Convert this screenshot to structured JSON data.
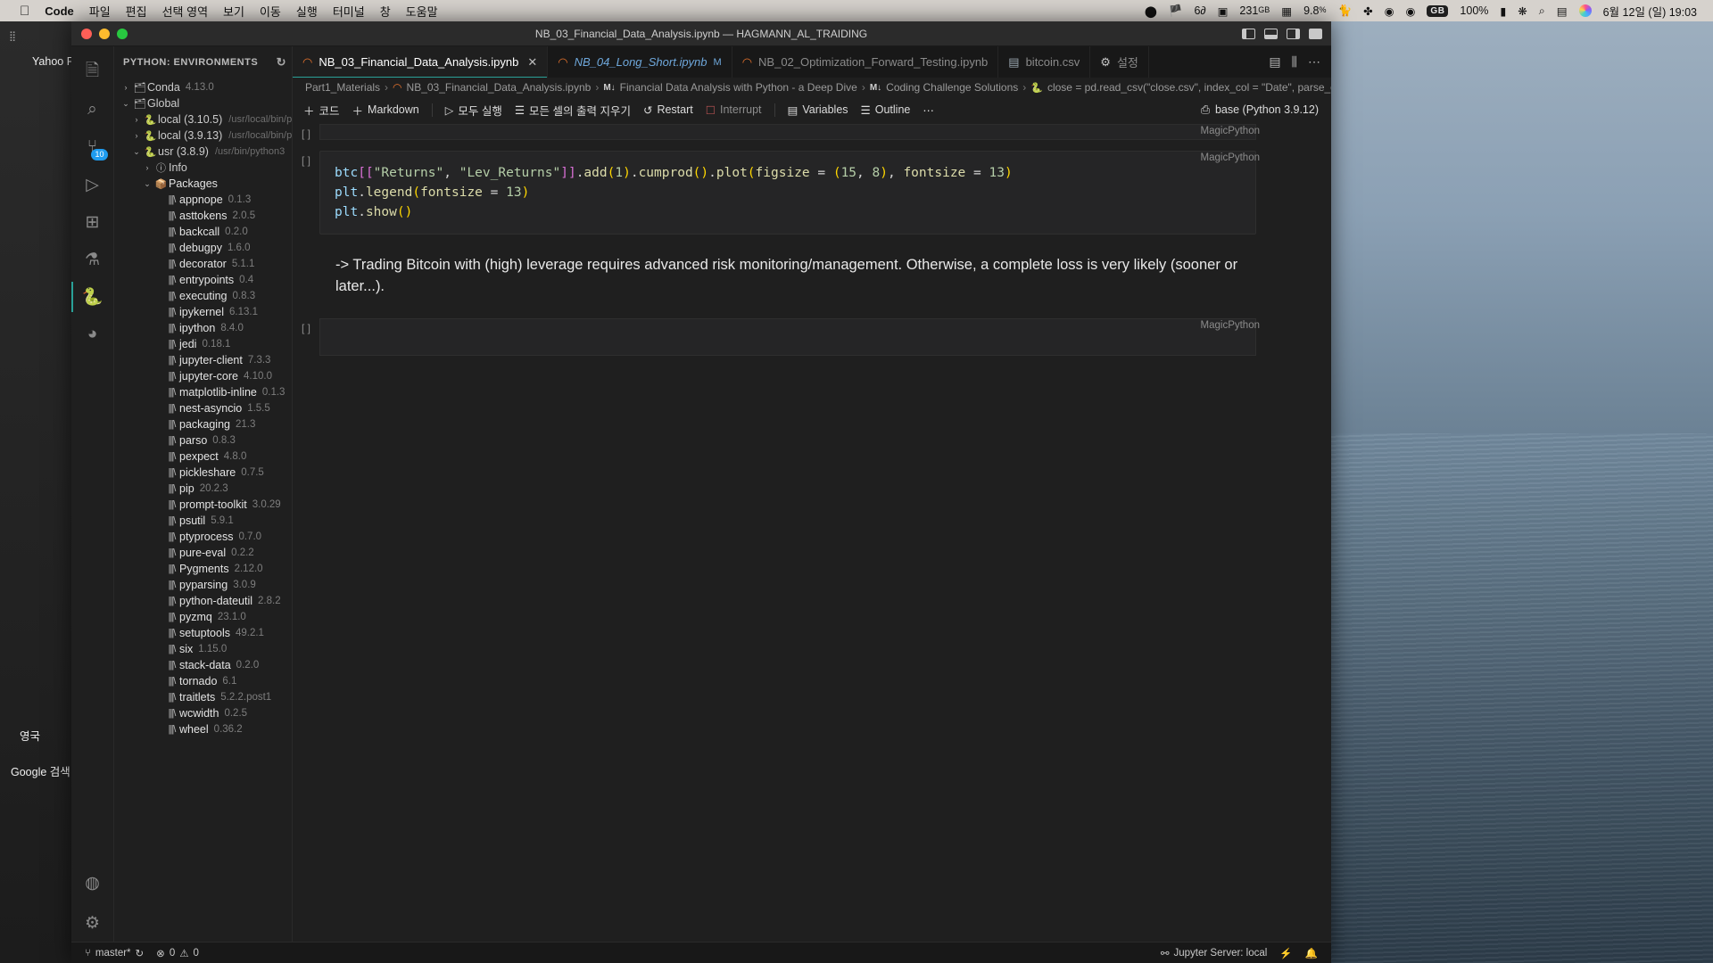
{
  "menubar": {
    "apple": "apple-logo",
    "app": "Code",
    "items": [
      "파일",
      "편집",
      "선택 영역",
      "보기",
      "이동",
      "실행",
      "터미널",
      "창",
      "도움말"
    ],
    "status": {
      "disk_value": "231",
      "disk_unit": "GB",
      "cpu_value": "9.8",
      "cpu_unit": "%",
      "input_source": "GB",
      "battery": "100%",
      "clock": "6월 12일 (일)  19:03"
    }
  },
  "desktop": {
    "left_items": [
      "Yahoo Fin",
      "영국",
      "Google 검색"
    ]
  },
  "window": {
    "title": "NB_03_Financial_Data_Analysis.ipynb — HAGMANN_AL_TRAIDING"
  },
  "activitybar": {
    "items": [
      {
        "name": "explorer",
        "glyph": "🗎",
        "badge": ""
      },
      {
        "name": "search",
        "glyph": "⌕",
        "badge": ""
      },
      {
        "name": "source-control",
        "glyph": "⑂",
        "badge": "10"
      },
      {
        "name": "run-and-debug",
        "glyph": "▷",
        "badge": ""
      },
      {
        "name": "extensions",
        "glyph": "⊞",
        "badge": ""
      },
      {
        "name": "testing",
        "glyph": "⚗",
        "badge": ""
      },
      {
        "name": "python-environments",
        "glyph": "🐍",
        "badge": ""
      },
      {
        "name": "github",
        "glyph": "◕",
        "badge": ""
      }
    ],
    "bottom": [
      {
        "name": "accounts",
        "glyph": "◍"
      },
      {
        "name": "manage-settings",
        "glyph": "⚙"
      }
    ]
  },
  "sidebar": {
    "title": "PYTHON: ENVIRONMENTS",
    "refresh_icon": "↻",
    "tree": [
      {
        "indent": 0,
        "twisty": "›",
        "icon": "env",
        "name": "Conda",
        "ver": "4.13.0",
        "path": ""
      },
      {
        "indent": 0,
        "twisty": "⌄",
        "icon": "env",
        "name": "Global",
        "ver": "",
        "path": ""
      },
      {
        "indent": 1,
        "twisty": "›",
        "icon": "py",
        "name": "local (3.10.5)",
        "ver": "",
        "path": "/usr/local/bin/p..."
      },
      {
        "indent": 1,
        "twisty": "›",
        "icon": "py",
        "name": "local (3.9.13)",
        "ver": "",
        "path": "/usr/local/bin/p..."
      },
      {
        "indent": 1,
        "twisty": "⌄",
        "icon": "py",
        "name": "usr (3.8.9)",
        "ver": "",
        "path": "/usr/bin/python3"
      },
      {
        "indent": 2,
        "twisty": "›",
        "icon": "info",
        "name": "Info",
        "ver": "",
        "path": ""
      },
      {
        "indent": 2,
        "twisty": "⌄",
        "icon": "packages",
        "name": "Packages",
        "ver": "",
        "path": ""
      },
      {
        "indent": 3,
        "twisty": "",
        "icon": "pkg",
        "name": "appnope",
        "ver": "0.1.3",
        "path": ""
      },
      {
        "indent": 3,
        "twisty": "",
        "icon": "pkg",
        "name": "asttokens",
        "ver": "2.0.5",
        "path": ""
      },
      {
        "indent": 3,
        "twisty": "",
        "icon": "pkg",
        "name": "backcall",
        "ver": "0.2.0",
        "path": ""
      },
      {
        "indent": 3,
        "twisty": "",
        "icon": "pkg",
        "name": "debugpy",
        "ver": "1.6.0",
        "path": ""
      },
      {
        "indent": 3,
        "twisty": "",
        "icon": "pkg",
        "name": "decorator",
        "ver": "5.1.1",
        "path": ""
      },
      {
        "indent": 3,
        "twisty": "",
        "icon": "pkg",
        "name": "entrypoints",
        "ver": "0.4",
        "path": ""
      },
      {
        "indent": 3,
        "twisty": "",
        "icon": "pkg",
        "name": "executing",
        "ver": "0.8.3",
        "path": ""
      },
      {
        "indent": 3,
        "twisty": "",
        "icon": "pkg",
        "name": "ipykernel",
        "ver": "6.13.1",
        "path": ""
      },
      {
        "indent": 3,
        "twisty": "",
        "icon": "pkg",
        "name": "ipython",
        "ver": "8.4.0",
        "path": ""
      },
      {
        "indent": 3,
        "twisty": "",
        "icon": "pkg",
        "name": "jedi",
        "ver": "0.18.1",
        "path": ""
      },
      {
        "indent": 3,
        "twisty": "",
        "icon": "pkg",
        "name": "jupyter-client",
        "ver": "7.3.3",
        "path": ""
      },
      {
        "indent": 3,
        "twisty": "",
        "icon": "pkg",
        "name": "jupyter-core",
        "ver": "4.10.0",
        "path": ""
      },
      {
        "indent": 3,
        "twisty": "",
        "icon": "pkg",
        "name": "matplotlib-inline",
        "ver": "0.1.3",
        "path": ""
      },
      {
        "indent": 3,
        "twisty": "",
        "icon": "pkg",
        "name": "nest-asyncio",
        "ver": "1.5.5",
        "path": ""
      },
      {
        "indent": 3,
        "twisty": "",
        "icon": "pkg",
        "name": "packaging",
        "ver": "21.3",
        "path": ""
      },
      {
        "indent": 3,
        "twisty": "",
        "icon": "pkg",
        "name": "parso",
        "ver": "0.8.3",
        "path": ""
      },
      {
        "indent": 3,
        "twisty": "",
        "icon": "pkg",
        "name": "pexpect",
        "ver": "4.8.0",
        "path": ""
      },
      {
        "indent": 3,
        "twisty": "",
        "icon": "pkg",
        "name": "pickleshare",
        "ver": "0.7.5",
        "path": ""
      },
      {
        "indent": 3,
        "twisty": "",
        "icon": "pkg",
        "name": "pip",
        "ver": "20.2.3",
        "path": ""
      },
      {
        "indent": 3,
        "twisty": "",
        "icon": "pkg",
        "name": "prompt-toolkit",
        "ver": "3.0.29",
        "path": ""
      },
      {
        "indent": 3,
        "twisty": "",
        "icon": "pkg",
        "name": "psutil",
        "ver": "5.9.1",
        "path": ""
      },
      {
        "indent": 3,
        "twisty": "",
        "icon": "pkg",
        "name": "ptyprocess",
        "ver": "0.7.0",
        "path": ""
      },
      {
        "indent": 3,
        "twisty": "",
        "icon": "pkg",
        "name": "pure-eval",
        "ver": "0.2.2",
        "path": ""
      },
      {
        "indent": 3,
        "twisty": "",
        "icon": "pkg",
        "name": "Pygments",
        "ver": "2.12.0",
        "path": ""
      },
      {
        "indent": 3,
        "twisty": "",
        "icon": "pkg",
        "name": "pyparsing",
        "ver": "3.0.9",
        "path": ""
      },
      {
        "indent": 3,
        "twisty": "",
        "icon": "pkg",
        "name": "python-dateutil",
        "ver": "2.8.2",
        "path": ""
      },
      {
        "indent": 3,
        "twisty": "",
        "icon": "pkg",
        "name": "pyzmq",
        "ver": "23.1.0",
        "path": ""
      },
      {
        "indent": 3,
        "twisty": "",
        "icon": "pkg",
        "name": "setuptools",
        "ver": "49.2.1",
        "path": ""
      },
      {
        "indent": 3,
        "twisty": "",
        "icon": "pkg",
        "name": "six",
        "ver": "1.15.0",
        "path": ""
      },
      {
        "indent": 3,
        "twisty": "",
        "icon": "pkg",
        "name": "stack-data",
        "ver": "0.2.0",
        "path": ""
      },
      {
        "indent": 3,
        "twisty": "",
        "icon": "pkg",
        "name": "tornado",
        "ver": "6.1",
        "path": ""
      },
      {
        "indent": 3,
        "twisty": "",
        "icon": "pkg",
        "name": "traitlets",
        "ver": "5.2.2.post1",
        "path": ""
      },
      {
        "indent": 3,
        "twisty": "",
        "icon": "pkg",
        "name": "wcwidth",
        "ver": "0.2.5",
        "path": ""
      },
      {
        "indent": 3,
        "twisty": "",
        "icon": "pkg",
        "name": "wheel",
        "ver": "0.36.2",
        "path": ""
      }
    ]
  },
  "tabs": [
    {
      "label": "NB_03_Financial_Data_Analysis.ipynb",
      "state": "active",
      "close": "✕",
      "modified": ""
    },
    {
      "label": "NB_04_Long_Short.ipynb",
      "state": "preview",
      "close": "",
      "modified": "M"
    },
    {
      "label": "NB_02_Optimization_Forward_Testing.ipynb",
      "state": "inactive",
      "close": "",
      "modified": ""
    },
    {
      "label": "bitcoin.csv",
      "state": "inactive",
      "close": "",
      "modified": ""
    },
    {
      "label": "설정",
      "state": "inactive",
      "close": "",
      "modified": ""
    }
  ],
  "tabs_right": {
    "split_icon": "⫼",
    "layout_icon": "▤",
    "more_icon": "⋯"
  },
  "breadcrumb": [
    {
      "label": "Part1_Materials",
      "icon": ""
    },
    {
      "label": "NB_03_Financial_Data_Analysis.ipynb",
      "icon": "jupyter"
    },
    {
      "label": "Financial Data Analysis with Python - a Deep Dive",
      "icon": "markdown"
    },
    {
      "label": "Coding Challenge Solutions",
      "icon": "markdown"
    },
    {
      "label": "close = pd.read_csv(\"close.csv\", index_col = \"Date\", parse_dates = [\"Date\"])",
      "icon": "python"
    }
  ],
  "nbtoolbar": {
    "add_code": "코드",
    "add_markdown": "Markdown",
    "run_all": "모두 실행",
    "clear_outputs": "모든 셀의 출력 지우기",
    "restart": "Restart",
    "interrupt": "Interrupt",
    "variables": "Variables",
    "outline": "Outline",
    "more": "⋯",
    "kernel": "base (Python 3.9.12)",
    "kernel_icon": "kernel-icon"
  },
  "notebook": {
    "cells": [
      {
        "type": "empty",
        "exec": "[ ]",
        "lang": "MagicPython"
      },
      {
        "type": "code",
        "exec": "[ ]",
        "lang": "MagicPython",
        "lines": [
          "btc[[\"Returns\", \"Lev_Returns\"]].add(1).cumprod().plot(figsize = (15, 8), fontsize = 13)",
          "plt.legend(fontsize = 13)",
          "plt.show()"
        ]
      },
      {
        "type": "markdown",
        "exec": "",
        "lang": "",
        "text": "-> Trading Bitcoin with (high) leverage requires advanced risk monitoring/management. Otherwise, a complete loss is very likely (sooner or later...)."
      },
      {
        "type": "blank",
        "exec": "[ ]",
        "lang": "MagicPython"
      }
    ]
  },
  "statusbar": {
    "branch_icon": "⑂",
    "branch": "master*",
    "sync_icon": "↻",
    "errors_icon": "⊗",
    "errors": "0",
    "warnings_icon": "⚠",
    "warnings": "0",
    "jupyter_server_icon": "⚯",
    "jupyter_server": "Jupyter Server: local",
    "remote_icon": "⚡",
    "bell_icon": "🔔"
  }
}
